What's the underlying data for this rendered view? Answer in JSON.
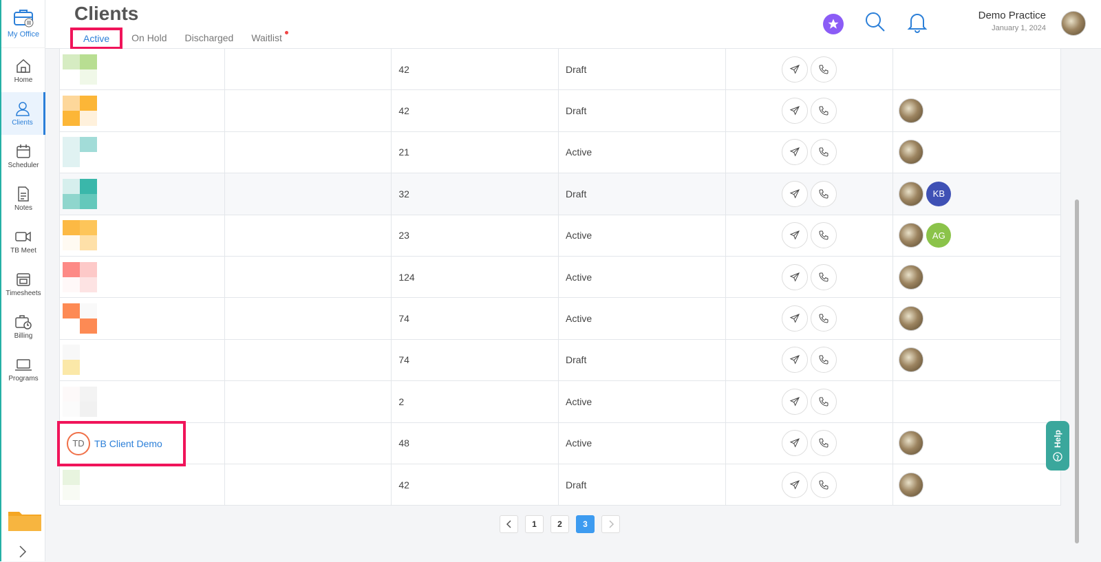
{
  "sidebar": {
    "office_label": "My Office",
    "items": [
      {
        "label": "Home",
        "icon": "home-icon"
      },
      {
        "label": "Clients",
        "icon": "user-icon",
        "active": true
      },
      {
        "label": "Scheduler",
        "icon": "calendar-icon"
      },
      {
        "label": "Notes",
        "icon": "document-icon"
      },
      {
        "label": "TB Meet",
        "icon": "video-icon"
      },
      {
        "label": "Timesheets",
        "icon": "timesheet-icon"
      },
      {
        "label": "Billing",
        "icon": "billing-icon"
      },
      {
        "label": "Programs",
        "icon": "laptop-icon"
      }
    ]
  },
  "header": {
    "title": "Clients",
    "tabs": [
      "Active",
      "On Hold",
      "Discharged",
      "Waitlist"
    ],
    "practice_name": "Demo Practice",
    "practice_date": "January 1, 2024"
  },
  "rows": [
    {
      "num": "42",
      "status": "Draft",
      "pix": [
        "#d6ecc2",
        "#b8de92",
        "#ffffff",
        "#f0f8e8"
      ],
      "staff": []
    },
    {
      "num": "42",
      "status": "Draft",
      "pix": [
        "#fdd79a",
        "#fcb637",
        "#fcb637",
        "#fff1dc"
      ],
      "staff": [
        "photo"
      ]
    },
    {
      "num": "21",
      "status": "Active",
      "pix": [
        "#e0f2f2",
        "#a2dcd8",
        "#e0f2f2",
        "#ffffff"
      ],
      "staff": [
        "photo"
      ]
    },
    {
      "num": "32",
      "status": "Draft",
      "pix": [
        "#d6efed",
        "#3ab7aa",
        "#8fd6cd",
        "#64c8bb"
      ],
      "staff": [
        "photo",
        "KB"
      ]
    },
    {
      "num": "23",
      "status": "Active",
      "pix": [
        "#fcb944",
        "#fdc55a",
        "#fffaf2",
        "#fee0a8"
      ],
      "staff": [
        "photo",
        "AG"
      ]
    },
    {
      "num": "124",
      "status": "Active",
      "pix": [
        "#fd8a86",
        "#fdc9c8",
        "#fff8f8",
        "#fde3e3"
      ],
      "staff": [
        "photo"
      ]
    },
    {
      "num": "74",
      "status": "Active",
      "pix": [
        "#fd8a54",
        "#f9f9f9",
        "#ffffff",
        "#fd8a54"
      ],
      "staff": [
        "photo"
      ]
    },
    {
      "num": "74",
      "status": "Draft",
      "pix": [
        "#f8f8f8",
        "#ffffff",
        "#fbe8a8",
        "#ffffff"
      ],
      "staff": [
        "photo"
      ]
    },
    {
      "num": "2",
      "status": "Active",
      "pix": [
        "#fdf9f9",
        "#f3f3f3",
        "#fbfbfb",
        "#f1f1f1"
      ],
      "staff": []
    },
    {
      "num": "48",
      "status": "Active",
      "client_initials": "TD",
      "client_name": "TB Client Demo",
      "staff": [
        "photo"
      ]
    },
    {
      "num": "42",
      "status": "Draft",
      "pix": [
        "#e8f4df",
        "#ffffff",
        "#f8fbf4",
        "#ffffff"
      ],
      "staff": [
        "photo"
      ]
    }
  ],
  "pagination": {
    "pages": [
      "1",
      "2",
      "3"
    ],
    "current": "3"
  },
  "help_label": "Help",
  "colors": {
    "accent": "#2b7fd8",
    "highlight": "#f0145a",
    "help": "#3aa79c",
    "star": "#8b5cf6",
    "kb": "#3f51b5",
    "ag": "#8bc34a"
  }
}
